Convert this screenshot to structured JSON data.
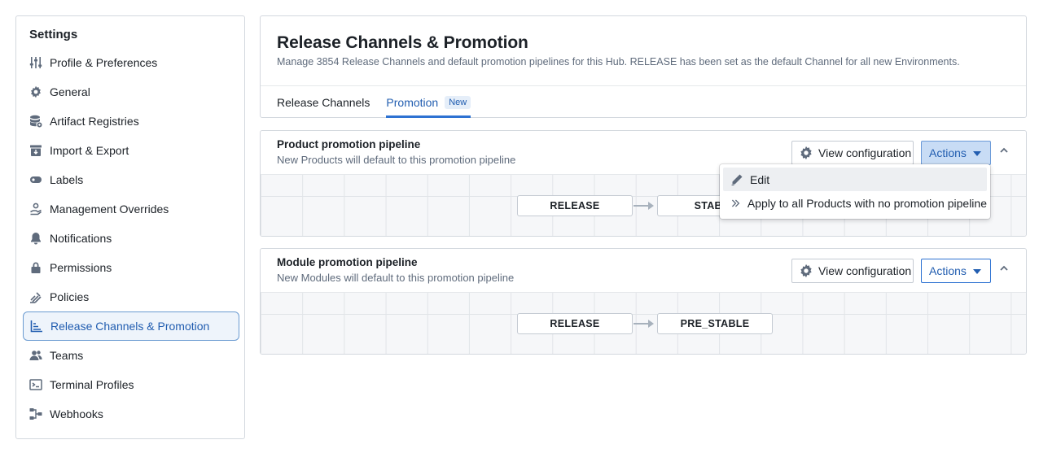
{
  "sidebar": {
    "title": "Settings",
    "items": [
      {
        "label": "Profile & Preferences",
        "icon": "sliders-icon"
      },
      {
        "label": "General",
        "icon": "gear-icon"
      },
      {
        "label": "Artifact Registries",
        "icon": "database-icon"
      },
      {
        "label": "Import & Export",
        "icon": "archive-icon"
      },
      {
        "label": "Labels",
        "icon": "tag-icon"
      },
      {
        "label": "Management Overrides",
        "icon": "hand-icon"
      },
      {
        "label": "Notifications",
        "icon": "bell-icon"
      },
      {
        "label": "Permissions",
        "icon": "lock-icon"
      },
      {
        "label": "Policies",
        "icon": "policy-icon"
      },
      {
        "label": "Release Channels & Promotion",
        "icon": "chart-icon",
        "active": true
      },
      {
        "label": "Teams",
        "icon": "people-icon"
      },
      {
        "label": "Terminal Profiles",
        "icon": "terminal-icon"
      },
      {
        "label": "Webhooks",
        "icon": "flow-icon"
      }
    ]
  },
  "header": {
    "title": "Release Channels & Promotion",
    "description": "Manage 3854 Release Channels and default promotion pipelines for this Hub. RELEASE has been set as the default Channel for all new Environments.",
    "tabs": [
      {
        "label": "Release Channels"
      },
      {
        "label": "Promotion",
        "badge": "New",
        "active": true
      }
    ]
  },
  "pipelines": [
    {
      "title": "Product promotion pipeline",
      "subtitle": "New Products will default to this promotion pipeline",
      "config_label": "View configuration",
      "actions_label": "Actions",
      "nodes": [
        "RELEASE",
        "STABLE"
      ]
    },
    {
      "title": "Module promotion pipeline",
      "subtitle": "New Modules will default to this promotion pipeline",
      "config_label": "View configuration",
      "actions_label": "Actions",
      "nodes": [
        "RELEASE",
        "PRE_STABLE"
      ]
    }
  ],
  "actions_menu": {
    "items": [
      {
        "label": "Edit",
        "icon": "pencil-icon"
      },
      {
        "label": "Apply to all Products with no promotion pipeline",
        "icon": "double-chevron-right-icon"
      }
    ]
  },
  "colors": {
    "accent": "#2d72d2",
    "accent_text": "#215db0",
    "muted": "#5f6b7c",
    "border": "#d3d8de"
  }
}
